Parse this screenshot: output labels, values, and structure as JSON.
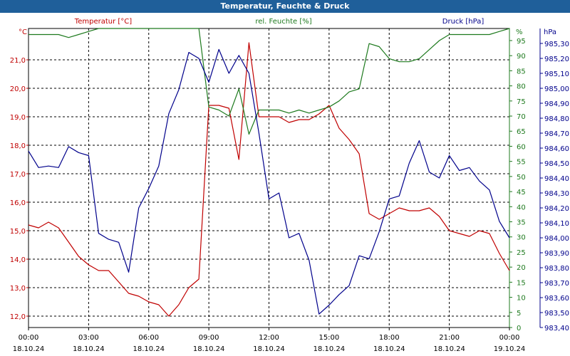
{
  "window": {
    "title": "Temperatur, Feuchte & Druck"
  },
  "colors": {
    "temperature": "#c00000",
    "humidity": "#1e7a1e",
    "pressure": "#00008b",
    "title_bg": "#1f5f9a"
  },
  "chart_data": {
    "type": "line",
    "title": "Temperatur, Feuchte & Druck",
    "grid": true,
    "x_ticks": [
      {
        "time": "00:00",
        "date": "18.10.24"
      },
      {
        "time": "03:00",
        "date": "18.10.24"
      },
      {
        "time": "06:00",
        "date": "18.10.24"
      },
      {
        "time": "09:00",
        "date": "18.10.24"
      },
      {
        "time": "12:00",
        "date": "18.10.24"
      },
      {
        "time": "15:00",
        "date": "18.10.24"
      },
      {
        "time": "18:00",
        "date": "18.10.24"
      },
      {
        "time": "21:00",
        "date": "18.10.24"
      },
      {
        "time": "00:00",
        "date": "19.10.24"
      }
    ],
    "axes": {
      "temperature": {
        "unit": "°C",
        "ylim": [
          11.6,
          22.1
        ],
        "ticks": [
          "12,0",
          "13,0",
          "14,0",
          "15,0",
          "16,0",
          "17,0",
          "18,0",
          "19,0",
          "20,0",
          "21,0"
        ],
        "tick_values": [
          12,
          13,
          14,
          15,
          16,
          17,
          18,
          19,
          20,
          21
        ]
      },
      "humidity": {
        "unit": "%",
        "ylim": [
          0,
          99
        ],
        "ticks": [
          "0",
          "5",
          "10",
          "15",
          "20",
          "25",
          "30",
          "35",
          "40",
          "45",
          "50",
          "55",
          "60",
          "65",
          "70",
          "75",
          "80",
          "85",
          "90",
          "95"
        ],
        "tick_values": [
          0,
          5,
          10,
          15,
          20,
          25,
          30,
          35,
          40,
          45,
          50,
          55,
          60,
          65,
          70,
          75,
          80,
          85,
          90,
          95
        ],
        "top_label": "%"
      },
      "pressure": {
        "unit": "hPa",
        "ylim": [
          983.4,
          985.4
        ],
        "ticks": [
          "983,40",
          "983,50",
          "983,60",
          "983,70",
          "983,80",
          "983,90",
          "984,00",
          "984,10",
          "984,20",
          "984,30",
          "984,40",
          "984,50",
          "984,60",
          "984,70",
          "984,80",
          "984,90",
          "985,00",
          "985,10",
          "985,20",
          "985,30"
        ],
        "tick_values": [
          983.4,
          983.5,
          983.6,
          983.7,
          983.8,
          983.9,
          984.0,
          984.1,
          984.2,
          984.3,
          984.4,
          984.5,
          984.6,
          984.7,
          984.8,
          984.9,
          985.0,
          985.1,
          985.2,
          985.3
        ],
        "top_label": "hPa"
      }
    },
    "series": [
      {
        "name": "Temperatur [°C]",
        "axis": "temperature",
        "x": [
          0,
          0.5,
          1,
          1.5,
          2,
          2.5,
          3,
          3.5,
          4,
          4.5,
          5,
          5.5,
          6,
          6.5,
          7,
          7.5,
          8,
          8.5,
          9,
          9.5,
          10,
          10.5,
          11,
          11.5,
          12,
          12.5,
          13,
          13.5,
          14,
          14.5,
          15,
          15.5,
          16,
          16.5,
          17,
          17.5,
          18,
          18.5,
          19,
          19.5,
          20,
          20.5,
          21,
          21.5,
          22,
          22.5,
          23,
          23.5,
          24
        ],
        "y": [
          15.2,
          15.1,
          15.3,
          15.1,
          14.6,
          14.1,
          13.8,
          13.6,
          13.6,
          13.2,
          12.8,
          12.7,
          12.5,
          12.4,
          12.0,
          12.4,
          13.0,
          13.3,
          19.4,
          19.4,
          19.3,
          17.5,
          21.6,
          19.0,
          19.0,
          19.0,
          18.8,
          18.9,
          18.9,
          19.1,
          19.4,
          18.6,
          18.2,
          17.7,
          15.6,
          15.4,
          15.6,
          15.8,
          15.7,
          15.7,
          15.8,
          15.5,
          15.0,
          14.9,
          14.8,
          15.0,
          14.9,
          14.2,
          13.6
        ]
      },
      {
        "name": "rel. Feuchte [%]",
        "axis": "humidity",
        "x": [
          0,
          0.5,
          1,
          1.5,
          2,
          2.5,
          3,
          3.5,
          4,
          4.5,
          5,
          5.5,
          6,
          6.5,
          7,
          7.5,
          8,
          8.5,
          9,
          9.5,
          10,
          10.5,
          11,
          11.5,
          12,
          12.5,
          13,
          13.5,
          14,
          14.5,
          15,
          15.5,
          16,
          16.5,
          17,
          17.5,
          18,
          18.5,
          19,
          19.5,
          20,
          20.5,
          21,
          21.5,
          22,
          22.5,
          23,
          23.5,
          24
        ],
        "y": [
          97,
          97,
          97,
          97,
          96,
          97,
          98,
          99,
          99,
          99,
          99,
          99,
          99,
          99,
          99,
          99,
          99,
          99,
          73,
          72,
          70,
          79,
          64,
          72,
          72,
          72,
          71,
          72,
          71,
          72,
          73,
          75,
          78,
          79,
          94,
          93,
          89,
          88,
          88,
          89,
          92,
          95,
          97,
          97,
          97,
          97,
          97,
          98,
          99
        ]
      },
      {
        "name": "Druck [hPa]",
        "axis": "pressure",
        "x": [
          0,
          0.5,
          1,
          1.5,
          2,
          2.5,
          3,
          3.5,
          4,
          4.5,
          5,
          5.5,
          6,
          6.5,
          7,
          7.5,
          8,
          8.5,
          9,
          9.5,
          10,
          10.5,
          11,
          11.5,
          12,
          12.5,
          13,
          13.5,
          14,
          14.5,
          15,
          15.5,
          16,
          16.5,
          17,
          17.5,
          18,
          18.5,
          19,
          19.5,
          20,
          20.5,
          21,
          21.5,
          22,
          22.5,
          23,
          23.5,
          24
        ],
        "y": [
          984.58,
          984.47,
          984.48,
          984.47,
          984.61,
          984.57,
          984.55,
          984.03,
          983.99,
          983.97,
          983.77,
          984.2,
          984.33,
          984.48,
          984.83,
          984.99,
          985.24,
          985.2,
          985.04,
          985.26,
          985.1,
          985.22,
          985.1,
          984.7,
          984.26,
          984.3,
          984.0,
          984.03,
          983.85,
          983.49,
          983.55,
          983.62,
          983.68,
          983.88,
          983.86,
          984.04,
          984.26,
          984.28,
          984.5,
          984.65,
          984.44,
          984.4,
          984.55,
          984.45,
          984.47,
          984.38,
          984.32,
          984.11,
          984.0
        ]
      }
    ]
  }
}
